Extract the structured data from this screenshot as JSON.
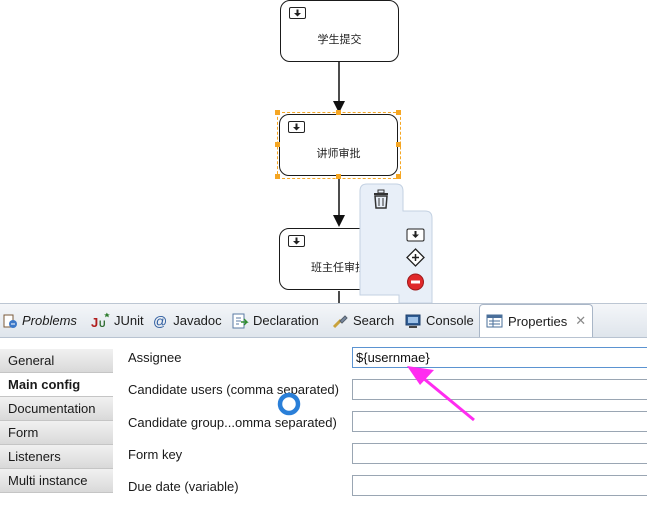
{
  "diagram": {
    "tasks": [
      {
        "label": "学生提交"
      },
      {
        "label": "讲师审批"
      },
      {
        "label": "班主任审批"
      }
    ]
  },
  "tabs": [
    {
      "label": "Problems",
      "icon": "problems-icon"
    },
    {
      "label": "JUnit",
      "icon": "junit-icon"
    },
    {
      "label": "Javadoc",
      "icon": "javadoc-icon"
    },
    {
      "label": "Declaration",
      "icon": "declaration-icon"
    },
    {
      "label": "Search",
      "icon": "search-icon"
    },
    {
      "label": "Console",
      "icon": "console-icon"
    },
    {
      "label": "Properties",
      "icon": "properties-icon",
      "close": "✕"
    }
  ],
  "sidebar": {
    "items": [
      {
        "label": "General"
      },
      {
        "label": "Main config"
      },
      {
        "label": "Documentation"
      },
      {
        "label": "Form"
      },
      {
        "label": "Listeners"
      },
      {
        "label": "Multi instance"
      }
    ]
  },
  "properties": {
    "fields": [
      {
        "label": "Assignee",
        "value": "${usernmae}"
      },
      {
        "label": "Candidate users (comma separated)",
        "value": ""
      },
      {
        "label": "Candidate group...omma separated)",
        "value": ""
      },
      {
        "label": "Form key",
        "value": ""
      },
      {
        "label": "Due date (variable)",
        "value": ""
      }
    ]
  },
  "colors": {
    "selection": "#f5a623",
    "arrow_annotation": "#ff2cf0",
    "tab_bar": "#dfe5ec"
  }
}
